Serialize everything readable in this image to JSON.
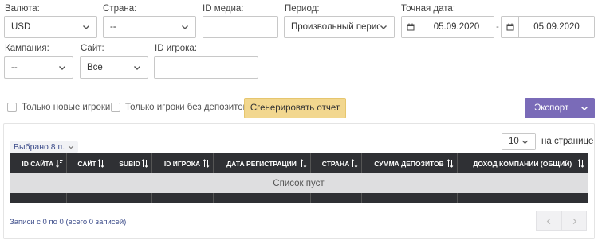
{
  "filters": {
    "currency": {
      "label": "Валюта:",
      "value": "USD"
    },
    "country": {
      "label": "Страна:",
      "value": "--"
    },
    "media_id": {
      "label": "ID медиа:",
      "value": ""
    },
    "period": {
      "label": "Период:",
      "value": "Произвольный период"
    },
    "exact_date": {
      "label": "Точная дата:",
      "from": "05.09.2020",
      "separator": "-",
      "to": "05.09.2020"
    },
    "campaign": {
      "label": "Кампания:",
      "value": "--"
    },
    "site": {
      "label": "Сайт:",
      "value": "Все"
    },
    "player_id": {
      "label": "ID игрока:",
      "value": ""
    }
  },
  "options": {
    "only_new_players": "Только новые игроки",
    "only_without_deposits": "Только игроки без депозитов"
  },
  "actions": {
    "generate_report": "Сгенерировать отчет",
    "export": "Экспорт"
  },
  "table": {
    "selected_columns": "Выбрано 8 п.",
    "per_page_value": "10",
    "per_page_label": "на странице",
    "columns": [
      "ID САЙТА",
      "САЙТ",
      "SUBID",
      "ID ИГРОКА",
      "ДАТА РЕГИСТРАЦИИ",
      "СТРАНА",
      "СУММА ДЕПОЗИТОВ",
      "ДОХОД КОМПАНИИ (ОБЩИЙ)"
    ],
    "empty_message": "Список пуст",
    "records_info": "Записи с 0 по 0 (всего 0 записей)"
  },
  "colors": {
    "header_bg": "#2f3034",
    "generate_button": "#f2d78f",
    "export_button": "#7a6bb8",
    "link_text": "#3f4f8c"
  },
  "icons": [
    "chevron-down-icon",
    "calendar-icon",
    "sort-asc-icon",
    "sort-icon",
    "chevron-left-icon",
    "chevron-right-icon"
  ]
}
